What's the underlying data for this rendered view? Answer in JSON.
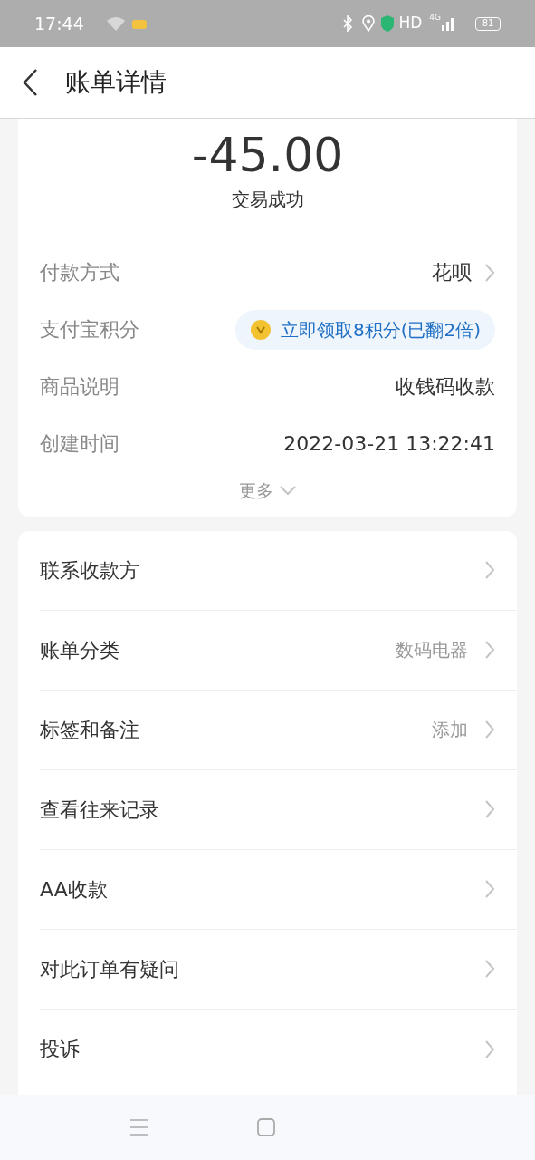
{
  "status_bar": {
    "time": "17:44",
    "network_label": "HD",
    "signal_label": "4G",
    "battery": "81"
  },
  "header": {
    "title": "账单详情"
  },
  "summary": {
    "amount": "-45.00",
    "status": "交易成功"
  },
  "details": [
    {
      "kind": "link",
      "label": "付款方式",
      "value": "花呗"
    },
    {
      "kind": "reward",
      "label": "支付宝积分",
      "value": "立即领取8积分(已翻2倍)"
    },
    {
      "kind": "plain",
      "label": "商品说明",
      "value": "收钱码收款"
    },
    {
      "kind": "plain",
      "label": "创建时间",
      "value": "2022-03-21 13:22:41"
    }
  ],
  "more": {
    "label": "更多",
    "expanded": false
  },
  "actions": [
    {
      "label": "联系收款方"
    },
    {
      "label": "账单分类",
      "value": "数码电器"
    },
    {
      "label": "标签和备注",
      "value": "添加"
    },
    {
      "label": "查看往来记录"
    },
    {
      "label": "AA收款"
    },
    {
      "label": "对此订单有疑问"
    },
    {
      "label": "投诉"
    }
  ]
}
